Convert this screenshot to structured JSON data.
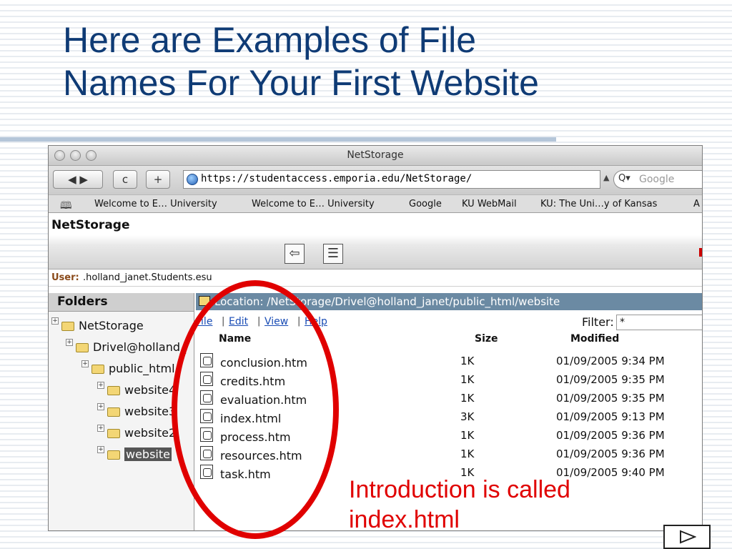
{
  "slide": {
    "title_line1": "Here are Examples of File",
    "title_line2": "Names For Your First Website",
    "caption_line1": "Introduction is called",
    "caption_line2": "index.html"
  },
  "window": {
    "title": "NetStorage",
    "toolbar": {
      "back_icon": "back-forward-icon",
      "reload_label": "c",
      "add_label": "+",
      "url": "https://studentaccess.emporia.edu/NetStorage/",
      "search_placeholder": "Google",
      "search_icon": "Q▾"
    },
    "bookmarks": [
      "Welcome to E… University",
      "Welcome to E… University",
      "Google",
      "KU WebMail",
      "KU: The Uni…y of Kansas",
      "A"
    ]
  },
  "app": {
    "name": "NetStorage",
    "user_label": "User:",
    "user_value": ".holland_janet.Students.esu",
    "folders_title": "Folders",
    "tree": [
      {
        "label": "NetStorage",
        "selected": false
      },
      {
        "label": "Drivel@holland_",
        "selected": false
      },
      {
        "label": "public_html",
        "selected": false
      },
      {
        "label": "website4",
        "selected": false
      },
      {
        "label": "website3",
        "selected": false
      },
      {
        "label": "website2",
        "selected": false
      },
      {
        "label": "website",
        "selected": true
      }
    ],
    "location": "Location: /NetStorage/Drivel@holland_janet/public_html/website",
    "menu": {
      "file": "File",
      "edit": "Edit",
      "view": "View",
      "help": "Help"
    },
    "filter_label": "Filter:",
    "filter_value": "*",
    "columns": {
      "name": "Name",
      "size": "Size",
      "modified": "Modified"
    },
    "files": [
      {
        "name": "conclusion.htm",
        "size": "1K",
        "modified": "01/09/2005 9:34 PM"
      },
      {
        "name": "credits.htm",
        "size": "1K",
        "modified": "01/09/2005 9:35 PM"
      },
      {
        "name": "evaluation.htm",
        "size": "1K",
        "modified": "01/09/2005 9:35 PM"
      },
      {
        "name": "index.html",
        "size": "3K",
        "modified": "01/09/2005 9:13 PM"
      },
      {
        "name": "process.htm",
        "size": "1K",
        "modified": "01/09/2005 9:36 PM"
      },
      {
        "name": "resources.htm",
        "size": "1K",
        "modified": "01/09/2005 9:36 PM"
      },
      {
        "name": "task.htm",
        "size": "1K",
        "modified": "01/09/2005 9:40 PM"
      }
    ]
  },
  "colors": {
    "title": "#0f3b75",
    "highlight": "#e00000",
    "location_bar": "#6b8aa3"
  }
}
